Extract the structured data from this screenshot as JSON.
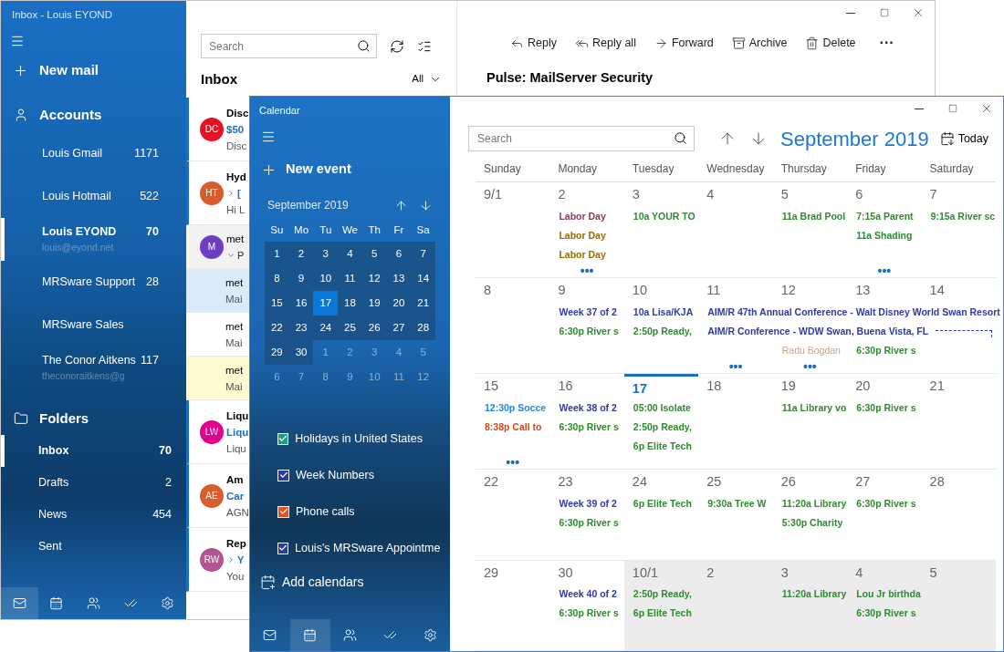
{
  "mail_window": {
    "title": "Inbox - Louis EYOND",
    "sidebar": {
      "new_mail": "New mail",
      "accounts_header": "Accounts",
      "accounts": [
        {
          "name": "Louis Gmail",
          "count": "1171",
          "selected": false
        },
        {
          "name": "Louis Hotmail",
          "count": "522",
          "selected": false
        },
        {
          "name": "Louis EYOND",
          "count": "70",
          "email": "louis@eyond.net",
          "selected": true
        },
        {
          "name": "MRSware Support",
          "count": "28",
          "selected": false
        },
        {
          "name": "MRSware Sales",
          "selected": false
        },
        {
          "name": "The Conor Aitkens",
          "count": "117",
          "email": "theconoraitkens@g",
          "selected": false
        }
      ],
      "folders_header": "Folders",
      "folders": [
        {
          "name": "Inbox",
          "count": "70",
          "selected": true
        },
        {
          "name": "Drafts",
          "count": "2",
          "selected": false
        },
        {
          "name": "News",
          "count": "454",
          "selected": false
        },
        {
          "name": "Sent",
          "selected": false
        }
      ],
      "nav": [
        {
          "kind": "mail",
          "selected": true
        },
        {
          "kind": "calendar",
          "selected": false
        },
        {
          "kind": "people",
          "selected": false
        },
        {
          "kind": "todo",
          "selected": false
        },
        {
          "kind": "settings",
          "selected": false
        }
      ]
    },
    "search": {
      "placeholder": "Search"
    },
    "list_title": "Inbox",
    "filter": "All",
    "messages": [
      {
        "kind": "message",
        "initials": "DC",
        "color": "#e81123",
        "unread": true,
        "selected": false,
        "flagged": false,
        "lines": [
          {
            "text": "Disc",
            "kind": "sender"
          },
          {
            "text": "$50",
            "kind": "link"
          },
          {
            "text": "Disc",
            "kind": "preview"
          }
        ]
      },
      {
        "kind": "message",
        "initials": "HT",
        "color": "#da5b2c",
        "unread": true,
        "selected": false,
        "flagged": false,
        "lines": [
          {
            "text": "Hyd",
            "kind": "sender"
          },
          {
            "text": "[",
            "kind": "thread"
          },
          {
            "text": "Hi L",
            "kind": "preview"
          }
        ]
      },
      {
        "kind": "conversation",
        "initials": "M",
        "color": "#6b3fbf",
        "unread": false,
        "selected": false,
        "flagged": false,
        "lines": [
          {
            "text": "met",
            "kind": "plain"
          },
          {
            "text": "P",
            "kind": "expanded"
          }
        ]
      },
      {
        "kind": "reply",
        "unread": false,
        "selected": true,
        "flagged": false,
        "lines": [
          {
            "text": "met",
            "kind": "plain"
          },
          {
            "text": "Mai",
            "kind": "preview"
          }
        ]
      },
      {
        "kind": "reply",
        "unread": false,
        "selected": false,
        "flagged": false,
        "lines": [
          {
            "text": "met",
            "kind": "plain"
          },
          {
            "text": "Mai",
            "kind": "preview"
          }
        ]
      },
      {
        "kind": "reply",
        "unread": false,
        "selected": false,
        "flagged": true,
        "lines": [
          {
            "text": "met",
            "kind": "plain"
          },
          {
            "text": "Mai",
            "kind": "preview"
          }
        ]
      },
      {
        "kind": "message",
        "initials": "LW",
        "color": "#e3008c",
        "unread": true,
        "selected": false,
        "flagged": false,
        "lines": [
          {
            "text": "Liqu",
            "kind": "sender"
          },
          {
            "text": "Liqu",
            "kind": "link"
          },
          {
            "text": "Liqu",
            "kind": "preview"
          }
        ]
      },
      {
        "kind": "message",
        "initials": "AE",
        "color": "#da5b2c",
        "unread": true,
        "selected": false,
        "flagged": false,
        "lines": [
          {
            "text": "Am",
            "kind": "sender"
          },
          {
            "text": "Car",
            "kind": "link"
          },
          {
            "text": "AGN",
            "kind": "preview"
          }
        ]
      },
      {
        "kind": "message",
        "initials": "RW",
        "color": "#b15693",
        "unread": true,
        "selected": false,
        "flagged": false,
        "lines": [
          {
            "text": "Rep",
            "kind": "sender"
          },
          {
            "text": "Y",
            "kind": "thread"
          },
          {
            "text": "You",
            "kind": "preview"
          }
        ]
      }
    ],
    "toolbar": [
      {
        "kind": "reply",
        "label": "Reply"
      },
      {
        "kind": "reply-all",
        "label": "Reply all"
      },
      {
        "kind": "forward",
        "label": "Forward"
      },
      {
        "kind": "archive",
        "label": "Archive"
      },
      {
        "kind": "delete",
        "label": "Delete"
      },
      {
        "kind": "more",
        "label": "···"
      }
    ],
    "message_title": "Pulse: MailServer Security"
  },
  "calendar_window": {
    "title": "Calendar",
    "new_event": "New event",
    "mini_month": {
      "label": "September 2019",
      "weekdays": [
        "Su",
        "Mo",
        "Tu",
        "We",
        "Th",
        "Fr",
        "Sa"
      ],
      "days": [
        {
          "day": "1",
          "in_month": true,
          "selected": false
        },
        {
          "day": "2",
          "in_month": true,
          "selected": false
        },
        {
          "day": "3",
          "in_month": true,
          "selected": false
        },
        {
          "day": "4",
          "in_month": true,
          "selected": false
        },
        {
          "day": "5",
          "in_month": true,
          "selected": false
        },
        {
          "day": "6",
          "in_month": true,
          "selected": false
        },
        {
          "day": "7",
          "in_month": true,
          "selected": false
        },
        {
          "day": "8",
          "in_month": true,
          "selected": false
        },
        {
          "day": "9",
          "in_month": true,
          "selected": false
        },
        {
          "day": "10",
          "in_month": true,
          "selected": false
        },
        {
          "day": "11",
          "in_month": true,
          "selected": false
        },
        {
          "day": "12",
          "in_month": true,
          "selected": false
        },
        {
          "day": "13",
          "in_month": true,
          "selected": false
        },
        {
          "day": "14",
          "in_month": true,
          "selected": false
        },
        {
          "day": "15",
          "in_month": true,
          "selected": false
        },
        {
          "day": "16",
          "in_month": true,
          "selected": false
        },
        {
          "day": "17",
          "in_month": true,
          "selected": true
        },
        {
          "day": "18",
          "in_month": true,
          "selected": false
        },
        {
          "day": "19",
          "in_month": true,
          "selected": false
        },
        {
          "day": "20",
          "in_month": true,
          "selected": false
        },
        {
          "day": "21",
          "in_month": true,
          "selected": false
        },
        {
          "day": "22",
          "in_month": true,
          "selected": false
        },
        {
          "day": "23",
          "in_month": true,
          "selected": false
        },
        {
          "day": "24",
          "in_month": true,
          "selected": false
        },
        {
          "day": "25",
          "in_month": true,
          "selected": false
        },
        {
          "day": "26",
          "in_month": true,
          "selected": false
        },
        {
          "day": "27",
          "in_month": true,
          "selected": false
        },
        {
          "day": "28",
          "in_month": true,
          "selected": false
        },
        {
          "day": "29",
          "in_month": true,
          "selected": false
        },
        {
          "day": "30",
          "in_month": true,
          "selected": false
        },
        {
          "day": "1",
          "in_month": false,
          "selected": false
        },
        {
          "day": "2",
          "in_month": false,
          "selected": false
        },
        {
          "day": "3",
          "in_month": false,
          "selected": false
        },
        {
          "day": "4",
          "in_month": false,
          "selected": false
        },
        {
          "day": "5",
          "in_month": false,
          "selected": false
        },
        {
          "day": "6",
          "in_month": false,
          "selected": false
        },
        {
          "day": "7",
          "in_month": false,
          "selected": false
        },
        {
          "day": "8",
          "in_month": false,
          "selected": false
        },
        {
          "day": "9",
          "in_month": false,
          "selected": false
        },
        {
          "day": "10",
          "in_month": false,
          "selected": false
        },
        {
          "day": "11",
          "in_month": false,
          "selected": false
        },
        {
          "day": "12",
          "in_month": false,
          "selected": false
        }
      ]
    },
    "calendars": [
      {
        "name": "Holidays in United States",
        "checked": true,
        "color": "#1f9e86"
      },
      {
        "name": "Week Numbers",
        "checked": true,
        "color": "#2d3aa6"
      },
      {
        "name": "Phone calls",
        "checked": true,
        "color": "#e8501c"
      },
      {
        "name": "Louis's MRSware Appointme",
        "checked": true,
        "color": "#2d3aa6"
      }
    ],
    "add_calendars": "Add calendars",
    "nav": [
      {
        "kind": "mail",
        "selected": false
      },
      {
        "kind": "calendar",
        "selected": true
      },
      {
        "kind": "people",
        "selected": false
      },
      {
        "kind": "todo",
        "selected": false
      },
      {
        "kind": "settings",
        "selected": false
      }
    ],
    "search": {
      "placeholder": "Search"
    },
    "month_title": "September 2019",
    "today": "Today",
    "weekdays": [
      "Sunday",
      "Monday",
      "Tuesday",
      "Wednesday",
      "Thursday",
      "Friday",
      "Saturday"
    ],
    "weeks": [
      {
        "days": [
          {
            "label": "9/1",
            "in_month": true,
            "today": false
          },
          {
            "label": "2",
            "in_month": true,
            "today": false,
            "more": "•••",
            "events": [
              {
                "text": "Labor Day",
                "color": "#8b3a62"
              },
              {
                "text": "Labor Day",
                "color": "#9a6b00"
              },
              {
                "text": "Labor Day",
                "color": "#9a6b00"
              }
            ]
          },
          {
            "label": "3",
            "in_month": true,
            "today": false,
            "events": [
              {
                "text": "10a YOUR TO",
                "color": "#2e8b2e"
              }
            ]
          },
          {
            "label": "4",
            "in_month": true,
            "today": false
          },
          {
            "label": "5",
            "in_month": true,
            "today": false,
            "events": [
              {
                "text": "11a Brad Pool",
                "color": "#2e8b2e"
              }
            ]
          },
          {
            "label": "6",
            "in_month": true,
            "today": false,
            "more": "•••",
            "events": [
              {
                "text": "7:15a Parent",
                "color": "#2e8b2e"
              },
              {
                "text": "11a Shading",
                "color": "#2e8b2e"
              }
            ]
          },
          {
            "label": "7",
            "in_month": true,
            "today": false,
            "events": [
              {
                "text": "9:15a River sc",
                "color": "#2e8b2e"
              }
            ]
          }
        ]
      },
      {
        "days": [
          {
            "label": "8",
            "in_month": true,
            "today": false
          },
          {
            "label": "9",
            "in_month": true,
            "today": false,
            "events": [
              {
                "text": "Week 37 of 2",
                "color": "#2d3aa6"
              },
              {
                "text": "6:30p River s",
                "color": "#2e8b2e"
              }
            ]
          },
          {
            "label": "10",
            "in_month": true,
            "today": false,
            "events": [
              {
                "text": "10a Lisa/KJA",
                "color": "#2d3aa6"
              },
              {
                "text": "2:50p Ready,",
                "color": "#2e8b2e"
              }
            ]
          },
          {
            "label": "11",
            "in_month": true,
            "today": false,
            "more": "•••",
            "events": [
              {
                "text": "AIM/R 47th Annual Conference - Walt Disney World Swan Resort",
                "color": "#2d3aa6",
                "kind": "multi-day"
              },
              {
                "text": "AIM/R Conference - WDW Swan, Buena Vista, FL",
                "color": "#2d3aa6",
                "kind": "multi-day-continued"
              }
            ]
          },
          {
            "label": "12",
            "in_month": true,
            "today": false,
            "more": "•••",
            "events": [
              {
                "text": "Radu Bogdan",
                "color": "#c9a48c",
                "kind": "faded"
              }
            ]
          },
          {
            "label": "13",
            "in_month": true,
            "today": false,
            "events": [
              {
                "text": "6:30p River s",
                "color": "#2e8b2e"
              }
            ]
          },
          {
            "label": "14",
            "in_month": true,
            "today": false
          }
        ]
      },
      {
        "days": [
          {
            "label": "15",
            "in_month": true,
            "today": false,
            "more": "•••",
            "events": [
              {
                "text": "12:30p Socce",
                "color": "#1e88e5"
              },
              {
                "text": "8:38p Call to",
                "color": "#d9481c"
              }
            ]
          },
          {
            "label": "16",
            "in_month": true,
            "today": false,
            "events": [
              {
                "text": "Week 38 of 2",
                "color": "#2d3aa6"
              },
              {
                "text": "6:30p River s",
                "color": "#2e8b2e"
              }
            ]
          },
          {
            "label": "17",
            "in_month": true,
            "today": true,
            "events": [
              {
                "text": "05:00 Isolate",
                "color": "#2e8b2e"
              },
              {
                "text": "2:50p Ready,",
                "color": "#2e8b2e"
              },
              {
                "text": "6p Elite Tech",
                "color": "#2e8b2e"
              }
            ]
          },
          {
            "label": "18",
            "in_month": true,
            "today": false
          },
          {
            "label": "19",
            "in_month": true,
            "today": false,
            "events": [
              {
                "text": "11a Library vo",
                "color": "#2e8b2e"
              }
            ]
          },
          {
            "label": "20",
            "in_month": true,
            "today": false,
            "events": [
              {
                "text": "6:30p River s",
                "color": "#2e8b2e"
              }
            ]
          },
          {
            "label": "21",
            "in_month": true,
            "today": false
          }
        ]
      },
      {
        "days": [
          {
            "label": "22",
            "in_month": true,
            "today": false
          },
          {
            "label": "23",
            "in_month": true,
            "today": false,
            "events": [
              {
                "text": "Week 39 of 2",
                "color": "#2d3aa6"
              },
              {
                "text": "6:30p River s",
                "color": "#2e8b2e"
              }
            ]
          },
          {
            "label": "24",
            "in_month": true,
            "today": false,
            "events": [
              {
                "text": "6p Elite Tech",
                "color": "#2e8b2e"
              }
            ]
          },
          {
            "label": "25",
            "in_month": true,
            "today": false,
            "events": [
              {
                "text": "9:30a Tree W",
                "color": "#2e8b2e"
              }
            ]
          },
          {
            "label": "26",
            "in_month": true,
            "today": false,
            "events": [
              {
                "text": "11:20a Library",
                "color": "#2e8b2e"
              },
              {
                "text": "5:30p Charity",
                "color": "#2e8b2e"
              }
            ]
          },
          {
            "label": "27",
            "in_month": true,
            "today": false,
            "events": [
              {
                "text": "6:30p River s",
                "color": "#2e8b2e"
              }
            ]
          },
          {
            "label": "28",
            "in_month": true,
            "today": false
          }
        ]
      },
      {
        "days": [
          {
            "label": "29",
            "in_month": true,
            "today": false
          },
          {
            "label": "30",
            "in_month": true,
            "today": false,
            "events": [
              {
                "text": "Week 40 of 2",
                "color": "#2d3aa6"
              },
              {
                "text": "6:30p River s",
                "color": "#2e8b2e"
              }
            ]
          },
          {
            "label": "10/1",
            "in_month": false,
            "today": false,
            "events": [
              {
                "text": "2:50p Ready,",
                "color": "#2e8b2e"
              },
              {
                "text": "6p Elite Tech",
                "color": "#2e8b2e"
              }
            ]
          },
          {
            "label": "2",
            "in_month": false,
            "today": false
          },
          {
            "label": "3",
            "in_month": false,
            "today": false,
            "events": [
              {
                "text": "11:20a Library",
                "color": "#2e8b2e"
              }
            ]
          },
          {
            "label": "4",
            "in_month": false,
            "today": false,
            "events": [
              {
                "text": "Lou Jr birthda",
                "color": "#2e8b2e"
              },
              {
                "text": "6:30p River s",
                "color": "#2e8b2e"
              }
            ]
          },
          {
            "label": "5",
            "in_month": false,
            "today": false
          }
        ]
      }
    ]
  }
}
